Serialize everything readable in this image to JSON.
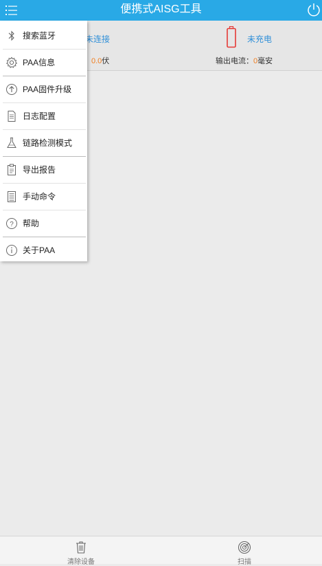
{
  "header": {
    "title": "便携式AISG工具"
  },
  "status": {
    "connection": "未连接",
    "voltage_value": "0.0",
    "voltage_unit": "伏",
    "charge_state": "未充电",
    "current_label": "输出电流：",
    "current_value": "0",
    "current_unit": "毫安"
  },
  "drawer": {
    "items": [
      {
        "label": "搜索蓝牙",
        "icon": "bluetooth-icon"
      },
      {
        "label": "PAA信息",
        "icon": "gear-icon"
      },
      {
        "label": "PAA固件升级",
        "icon": "upload-circle-icon"
      },
      {
        "label": "日志配置",
        "icon": "log-file-icon"
      },
      {
        "label": "链路检测模式",
        "icon": "flask-icon"
      },
      {
        "label": "导出报告",
        "icon": "clipboard-icon"
      },
      {
        "label": "手动命令",
        "icon": "list-icon"
      },
      {
        "label": "帮助",
        "icon": "help-icon"
      },
      {
        "label": "关于PAA",
        "icon": "info-icon"
      }
    ]
  },
  "bottom": {
    "clear_label": "清除设备",
    "scan_label": "扫描"
  },
  "colors": {
    "header_bg": "#29a9e6",
    "link_blue": "#2f8fd8",
    "value_orange": "#f07d1e",
    "battery_red": "#e53935"
  }
}
